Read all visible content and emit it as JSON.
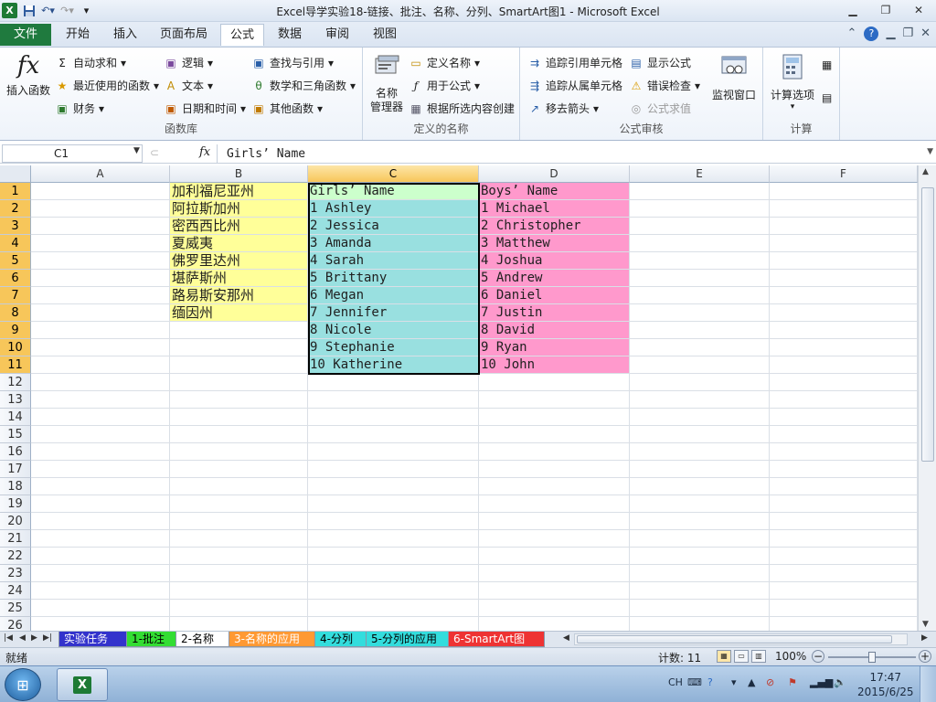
{
  "window": {
    "title": "Excel导学实验18-链接、批注、名称、分列、SmartArt图1 - Microsoft Excel"
  },
  "ribbon_tabs": {
    "file": "文件",
    "home": "开始",
    "insert": "插入",
    "layout": "页面布局",
    "formulas": "公式",
    "data": "数据",
    "review": "审阅",
    "view": "视图"
  },
  "ribbon": {
    "insert_function": "插入函数",
    "autosum": "自动求和",
    "recent": "最近使用的函数",
    "financial": "财务",
    "logical": "逻辑",
    "text": "文本",
    "datetime": "日期和时间",
    "lookup": "查找与引用",
    "math": "数学和三角函数",
    "more": "其他函数",
    "group_library": "函数库",
    "name_manager": "名称\n管理器",
    "define_name": "定义名称",
    "use_in_formula": "用于公式",
    "create_from_selection": "根据所选内容创建",
    "group_names": "定义的名称",
    "trace_precedents": "追踪引用单元格",
    "trace_dependents": "追踪从属单元格",
    "remove_arrows": "移去箭头",
    "show_formulas": "显示公式",
    "error_checking": "错误检查",
    "evaluate": "公式求值",
    "watch_window": "监视窗口",
    "group_auditing": "公式审核",
    "calc_options": "计算选项",
    "group_calc": "计算"
  },
  "formula_bar": {
    "name_box": "C1",
    "fx": "fx",
    "content": "Girls’ Name"
  },
  "columns": [
    "A",
    "B",
    "C",
    "D",
    "E",
    "F"
  ],
  "rows": [
    "1",
    "2",
    "3",
    "4",
    "5",
    "6",
    "7",
    "8",
    "9",
    "10",
    "11",
    "12",
    "13",
    "14",
    "15",
    "16",
    "17",
    "18",
    "19",
    "20",
    "21",
    "22",
    "23",
    "24",
    "25",
    "26"
  ],
  "cells": {
    "B": [
      "加利福尼亚州",
      "阿拉斯加州",
      "密西西比州",
      "夏威夷",
      "佛罗里达州",
      "堪萨斯州",
      "路易斯安那州",
      "缅因州"
    ],
    "C": [
      "Girls’ Name",
      "1 Ashley",
      "2 Jessica",
      "3 Amanda",
      "4 Sarah",
      "5 Brittany",
      "6 Megan",
      "7 Jennifer",
      "8 Nicole",
      "9 Stephanie",
      "10 Katherine"
    ],
    "D": [
      "Boys’ Name",
      "1 Michael",
      "2 Christopher",
      "3 Matthew",
      "4 Joshua",
      "5 Andrew",
      "6 Daniel",
      "7 Justin",
      "8 David",
      "9 Ryan",
      "10 John"
    ]
  },
  "fills": {
    "B": "#ffff99",
    "C": "#99e0e0",
    "C1": "#ccffcc",
    "D": "#ff99cc",
    "selected_header": "#f7c65a"
  },
  "sheet_tabs": [
    {
      "label": "实验任务",
      "color": "#3333cc",
      "text": "#ffffff"
    },
    {
      "label": "1-批注",
      "color": "#33dd33",
      "text": "#000000"
    },
    {
      "label": "2-名称",
      "color": "#ffffff",
      "text": "#000000",
      "active": true
    },
    {
      "label": "3-名称的应用",
      "color": "#ff9933",
      "text": "#ffffff"
    },
    {
      "label": "4-分列",
      "color": "#33dddd",
      "text": "#000000"
    },
    {
      "label": "5-分列的应用",
      "color": "#33dddd",
      "text": "#000000"
    },
    {
      "label": "6-SmartArt图",
      "color": "#ee3333",
      "text": "#ffffff"
    }
  ],
  "status": {
    "ready": "就绪",
    "count": "计数: 11",
    "zoom": "100%"
  },
  "taskbar": {
    "lang": "CH",
    "time": "17:47",
    "date": "2015/6/25"
  }
}
